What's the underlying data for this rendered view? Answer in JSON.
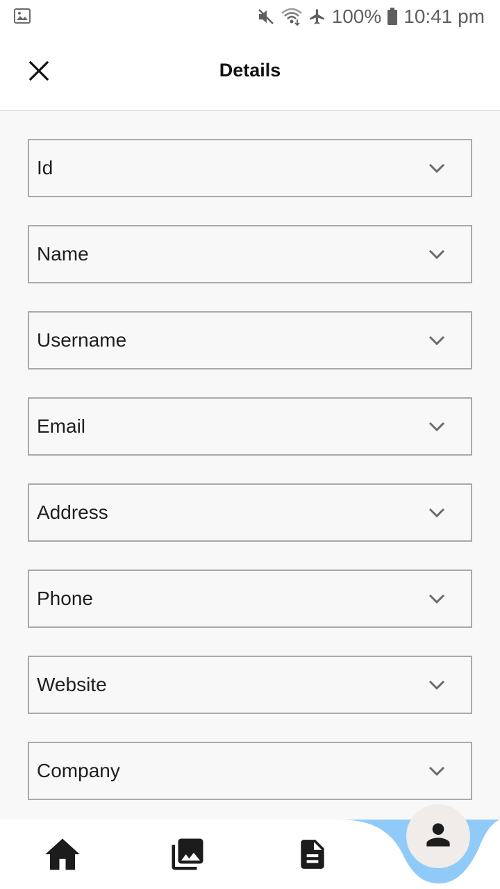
{
  "status_bar": {
    "battery": "100%",
    "time": "10:41 pm",
    "icons": [
      "gallery-notification-icon",
      "mute-icon",
      "wifi-icon",
      "airplane-icon",
      "battery-icon"
    ]
  },
  "header": {
    "title": "Details",
    "close_icon": "close-icon"
  },
  "fields": [
    {
      "label": "Id"
    },
    {
      "label": "Name"
    },
    {
      "label": "Username"
    },
    {
      "label": "Email"
    },
    {
      "label": "Address"
    },
    {
      "label": "Phone"
    },
    {
      "label": "Website"
    },
    {
      "label": "Company"
    }
  ],
  "bottom_nav": {
    "items": [
      "home-icon",
      "photo-library-icon",
      "document-icon",
      "person-icon"
    ],
    "active": "person-icon",
    "accent_color": "#90caf9"
  }
}
